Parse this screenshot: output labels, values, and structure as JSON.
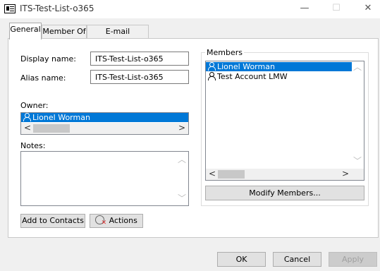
{
  "window": {
    "title": "ITS-Test-List-o365",
    "minimize": "—",
    "maximize": "☐",
    "close": "✕"
  },
  "tabs": [
    {
      "label": "General",
      "active": true
    },
    {
      "label": "Member Of",
      "active": false
    },
    {
      "label": "E-mail Addresses",
      "active": false
    }
  ],
  "general": {
    "display_name_label": "Display name:",
    "display_name_value": "ITS-Test-List-o365",
    "alias_name_label": "Alias name:",
    "alias_name_value": "ITS-Test-List-o365",
    "owner_label": "Owner:",
    "owner_value": "Lionel Worman",
    "notes_label": "Notes:",
    "notes_value": "",
    "add_to_contacts": "Add to Contacts",
    "actions": "Actions"
  },
  "members": {
    "label": "Members",
    "items": [
      {
        "name": "Lionel Worman",
        "selected": true
      },
      {
        "name": "Test Account LMW",
        "selected": false
      }
    ],
    "modify_button": "Modify Members..."
  },
  "footer": {
    "ok": "OK",
    "cancel": "Cancel",
    "apply": "Apply"
  },
  "colors": {
    "selection": "#0078d7",
    "background": "#f0f0f0",
    "panel": "#ffffff"
  }
}
